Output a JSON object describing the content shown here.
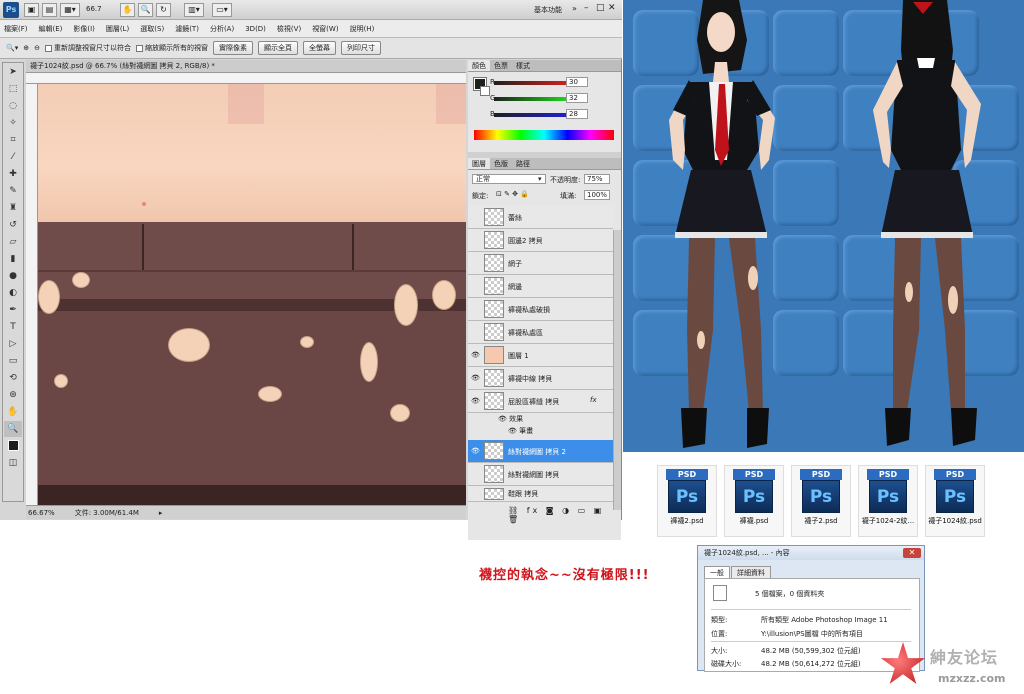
{
  "app": {
    "badge": "Ps",
    "zoom_select": "66.7",
    "workspace": "基本功能"
  },
  "menu": [
    "檔案(F)",
    "編輯(E)",
    "影像(I)",
    "圖層(L)",
    "選取(S)",
    "濾鏡(T)",
    "分析(A)",
    "3D(D)",
    "檢視(V)",
    "視窗(W)",
    "說明(H)"
  ],
  "options": {
    "resize_windows": "重新調整視窗尺寸以符合",
    "zoom_all": "縮放顯示所有的視窗",
    "actual_pixels": "實際像素",
    "fit_screen": "顯示全頁",
    "fill_screen": "全螢幕",
    "print_size": "列印尺寸"
  },
  "document": {
    "tab_title": "襪子1024紋.psd @ 66.7% (絲對襪網圖 拷貝 2, RGB/8) *",
    "zoom": "66.67%",
    "doc_size": "文件: 3.00M/61.4M"
  },
  "color_panel": {
    "tabs": [
      "顏色",
      "色票",
      "樣式"
    ],
    "r_label": "R",
    "g_label": "G",
    "b_label": "B",
    "r": "30",
    "g": "32",
    "b": "28"
  },
  "layers_panel": {
    "tabs": [
      "圖層",
      "色版",
      "路徑"
    ],
    "blend_mode": "正常",
    "opacity_label": "不透明度:",
    "opacity": "75%",
    "lock_label": "鎖定:",
    "fill_label": "填滿:",
    "fill": "100%",
    "layers": [
      {
        "name": "蕾絲",
        "visible": false,
        "selected": false
      },
      {
        "name": "圓邊2 拷貝",
        "visible": false,
        "selected": false
      },
      {
        "name": "網子",
        "visible": false,
        "selected": false
      },
      {
        "name": "網邊",
        "visible": false,
        "selected": false
      },
      {
        "name": "褲襪私處破損",
        "visible": false,
        "selected": false
      },
      {
        "name": "褲襪私處區",
        "visible": false,
        "selected": false
      },
      {
        "name": "圖層 1",
        "visible": true,
        "selected": false
      },
      {
        "name": "褲襪中線 拷貝",
        "visible": true,
        "selected": false
      },
      {
        "name": "屁股區褲縫 拷貝",
        "visible": true,
        "selected": false,
        "fx": "fx"
      },
      {
        "name": "絲對襪網圖 拷貝 2",
        "visible": true,
        "selected": true
      },
      {
        "name": "絲對襪網圖 拷貝",
        "visible": false,
        "selected": false
      },
      {
        "name": "鞋跟 拷貝",
        "visible": false,
        "selected": false
      }
    ],
    "effects_label": "效果",
    "stroke_label": "筆畫"
  },
  "files": [
    {
      "badge": "PSD",
      "glyph": "Ps",
      "name": "褲襪2.psd"
    },
    {
      "badge": "PSD",
      "glyph": "Ps",
      "name": "褲襪.psd"
    },
    {
      "badge": "PSD",
      "glyph": "Ps",
      "name": "襪子2.psd"
    },
    {
      "badge": "PSD",
      "glyph": "Ps",
      "name": "襪子1024-2紋..."
    },
    {
      "badge": "PSD",
      "glyph": "Ps",
      "name": "襪子1024紋.psd"
    }
  ],
  "tagline": "襪控的執念~~沒有極限!!!",
  "properties": {
    "title": "襪子1024紋.psd, ... - 內容",
    "tab_general": "一般",
    "tab_details": "詳細資料",
    "summary": "5 個檔案，0 個資料夾",
    "type_label": "類型:",
    "type_value": "所有類型 Adobe Photoshop Image 11",
    "location_label": "位置:",
    "location_value": "Y:\\illusion\\PS圖檔 中的所有項目",
    "size_label": "大小:",
    "size_value": "48.2 MB (50,599,302 位元組)",
    "disk_label": "磁碟大小:",
    "disk_value": "48.2 MB (50,614,272 位元組)"
  },
  "watermark": {
    "line1": "紳友论坛",
    "line2": "mzxzz.com"
  }
}
